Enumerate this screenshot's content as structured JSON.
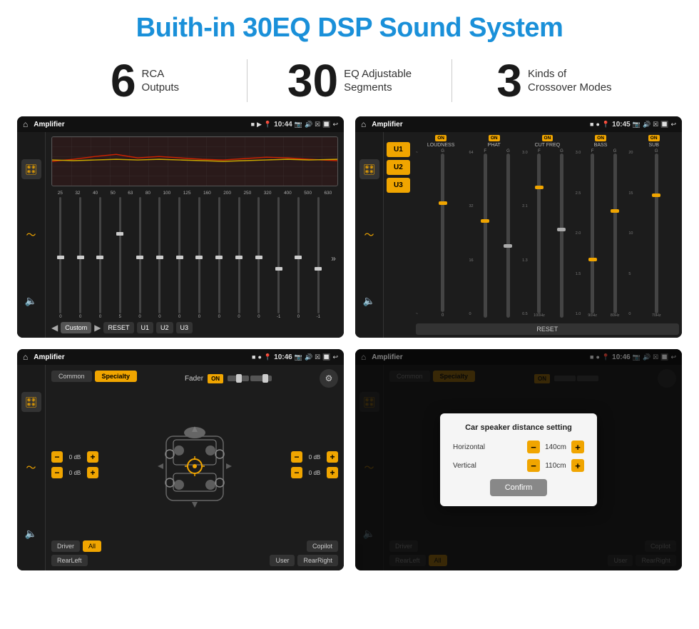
{
  "page": {
    "title": "Buith-in 30EQ DSP Sound System",
    "stats": [
      {
        "number": "6",
        "label": "RCA\nOutputs"
      },
      {
        "number": "30",
        "label": "EQ Adjustable\nSegments"
      },
      {
        "number": "3",
        "label": "Kinds of\nCrossover Modes"
      }
    ]
  },
  "screens": {
    "eq": {
      "title": "Amplifier",
      "time": "10:44",
      "freq_labels": [
        "25",
        "32",
        "40",
        "50",
        "63",
        "80",
        "100",
        "125",
        "160",
        "200",
        "250",
        "320",
        "400",
        "500",
        "630"
      ],
      "slider_values": [
        "0",
        "0",
        "0",
        "5",
        "0",
        "0",
        "0",
        "0",
        "0",
        "0",
        "0",
        "-1",
        "0",
        "-1"
      ],
      "preset": "Custom",
      "buttons": [
        "RESET",
        "U1",
        "U2",
        "U3"
      ]
    },
    "crossover": {
      "title": "Amplifier",
      "time": "10:45",
      "u_buttons": [
        "U1",
        "U2",
        "U3"
      ],
      "channels": [
        {
          "toggle": "ON",
          "name": "LOUDNESS"
        },
        {
          "toggle": "ON",
          "name": "PHAT"
        },
        {
          "toggle": "ON",
          "name": "CUT FREQ"
        },
        {
          "toggle": "ON",
          "name": "BASS"
        },
        {
          "toggle": "ON",
          "name": "SUB"
        }
      ],
      "reset_label": "RESET"
    },
    "fader": {
      "title": "Amplifier",
      "time": "10:46",
      "tabs": [
        "Common",
        "Specialty"
      ],
      "active_tab": "Specialty",
      "fader_label": "Fader",
      "fader_toggle": "ON",
      "vol_rows": [
        {
          "value": "0 dB"
        },
        {
          "value": "0 dB"
        },
        {
          "value": "0 dB"
        },
        {
          "value": "0 dB"
        }
      ],
      "buttons": [
        "Driver",
        "RearLeft",
        "All",
        "Copilot",
        "User",
        "RearRight"
      ]
    },
    "dialog": {
      "title": "Amplifier",
      "time": "10:46",
      "tabs": [
        "Common",
        "Specialty"
      ],
      "dialog": {
        "title": "Car speaker distance setting",
        "horizontal_label": "Horizontal",
        "horizontal_value": "140cm",
        "vertical_label": "Vertical",
        "vertical_value": "110cm",
        "confirm_label": "Confirm"
      },
      "buttons": [
        "Driver",
        "RearLeft",
        "All",
        "Copilot",
        "User",
        "RearRight"
      ]
    }
  }
}
